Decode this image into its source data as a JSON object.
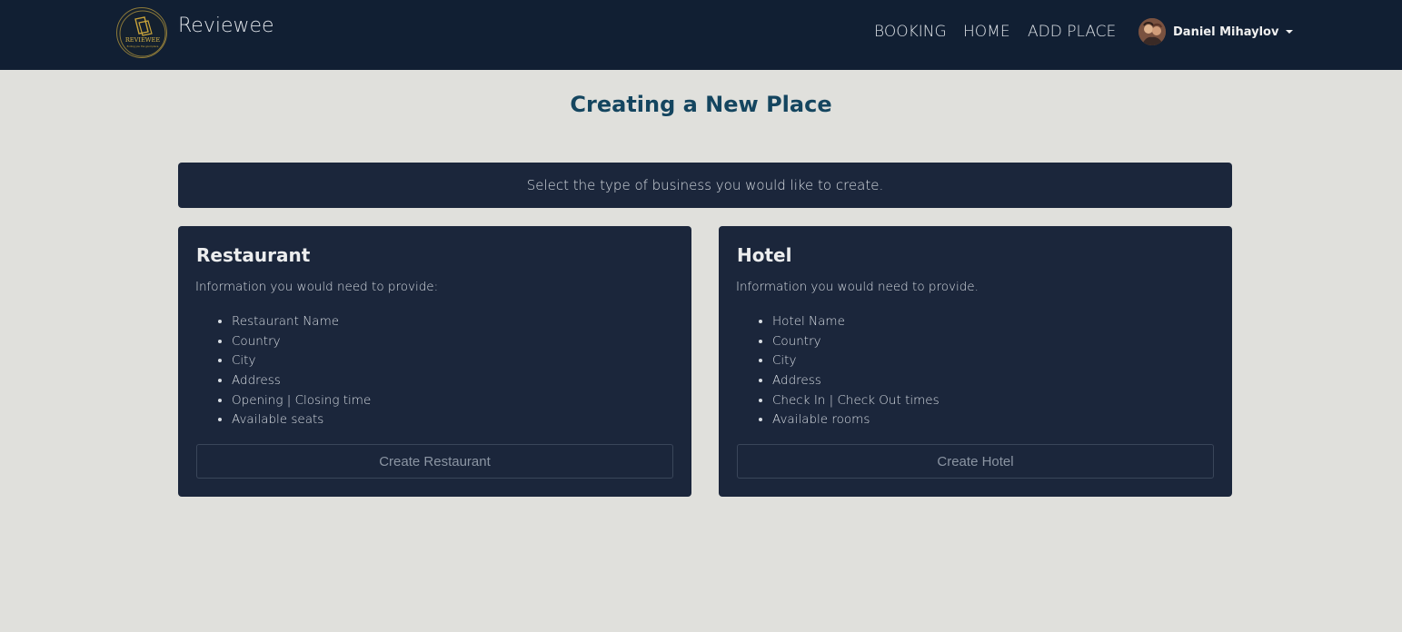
{
  "header": {
    "brand_name": "Reviewee",
    "logo_text": "REVIEWEE",
    "logo_tagline": "finding you the good place",
    "nav": {
      "booking": "BOOKING",
      "home": "HOME",
      "add_place": "ADD PLACE"
    },
    "user": {
      "name": "Daniel Mihaylov"
    }
  },
  "main": {
    "title": "Creating a New Place",
    "banner": "Select the type of business you would like to create.",
    "cards": [
      {
        "title": "Restaurant",
        "intro": "Information you would need to provide:",
        "items": [
          "Restaurant Name",
          "Country",
          "City",
          "Address",
          "Opening | Closing time",
          "Available seats"
        ],
        "button": "Create Restaurant"
      },
      {
        "title": "Hotel",
        "intro": "Information you would need to provide.",
        "items": [
          "Hotel Name",
          "Country",
          "City",
          "Address",
          "Check In | Check Out times",
          "Available rooms"
        ],
        "button": "Create Hotel"
      }
    ]
  },
  "colors": {
    "navbar": "#111f33",
    "page_bg": "#e0e0dc",
    "card_bg": "#1b263b",
    "title": "#14455f",
    "logo_gold": "#c9a43a"
  },
  "icons": {
    "logo": "reviewee-logo",
    "avatar": "user-avatar",
    "caret": "caret-down-icon"
  }
}
